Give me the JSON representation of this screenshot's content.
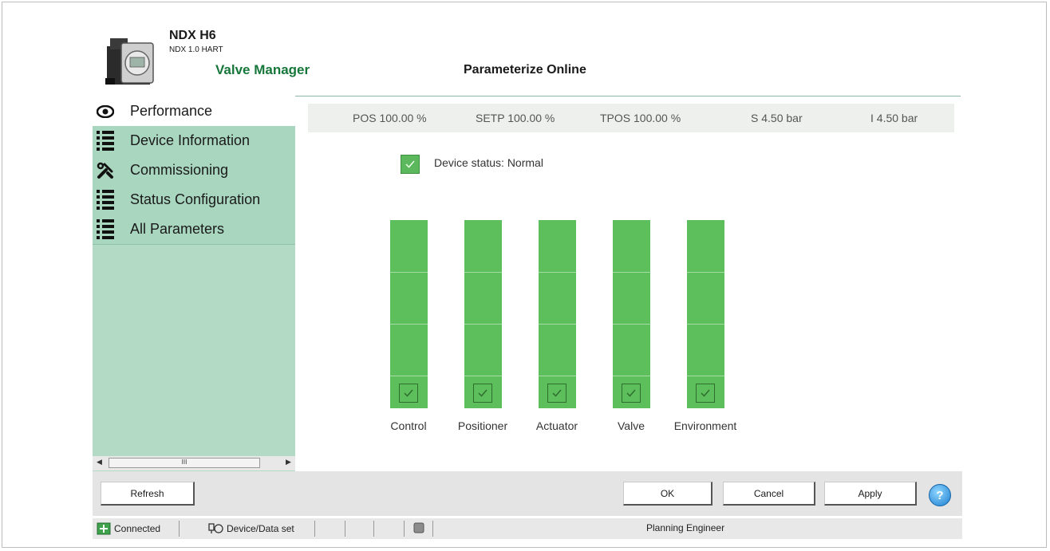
{
  "header": {
    "device_name": "NDX H6",
    "device_sub": "NDX 1.0 HART",
    "app_name": "Valve Manager",
    "page_title": "Parameterize Online"
  },
  "sidebar": {
    "items": [
      {
        "label": "Performance",
        "icon": "eye-icon",
        "active": true
      },
      {
        "label": "Device Information",
        "icon": "list-icon",
        "active": false
      },
      {
        "label": "Commissioning",
        "icon": "tools-icon",
        "active": false
      },
      {
        "label": "Status Configuration",
        "icon": "list-icon",
        "active": false
      },
      {
        "label": "All Parameters",
        "icon": "list-icon",
        "active": false
      }
    ],
    "scroll_thumb": "III"
  },
  "readouts": [
    {
      "label": "POS",
      "value": "100.00",
      "unit": "%"
    },
    {
      "label": "SETP",
      "value": "100.00",
      "unit": "%"
    },
    {
      "label": "TPOS",
      "value": "100.00",
      "unit": "%"
    },
    {
      "label": "S",
      "value": "4.50",
      "unit": "bar"
    },
    {
      "label": "I",
      "value": "4.50",
      "unit": "bar"
    }
  ],
  "readout_text": [
    "POS  100.00  %",
    "SETP  100.00  %",
    "TPOS  100.00  %",
    "S  4.50  bar",
    "I  4.50  bar"
  ],
  "device_status": "Device status: Normal",
  "status_bars": [
    {
      "label": "Control"
    },
    {
      "label": "Positioner"
    },
    {
      "label": "Actuator"
    },
    {
      "label": "Valve"
    },
    {
      "label": "Environment"
    }
  ],
  "buttons": {
    "refresh": "Refresh",
    "ok": "OK",
    "cancel": "Cancel",
    "apply": "Apply",
    "help": "?"
  },
  "status_bar": {
    "connection": "Connected",
    "device_data_set": "Device/Data set",
    "role": "Planning Engineer"
  },
  "colors": {
    "accent_green": "#17773a",
    "sidebar_bg": "#b2dac5",
    "status_ok": "#5cbf5c"
  }
}
